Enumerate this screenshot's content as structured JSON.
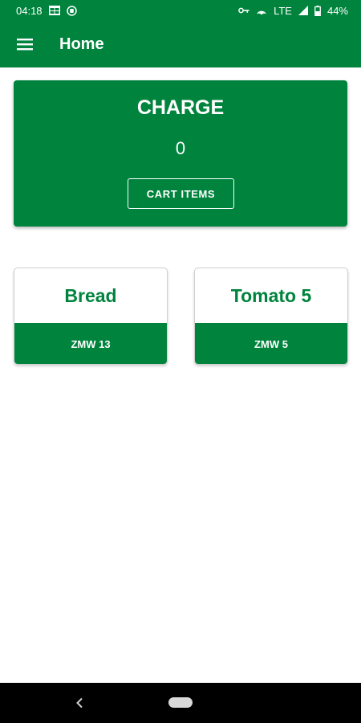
{
  "status_bar": {
    "time": "04:18",
    "network": "LTE",
    "battery": "44%",
    "icons": [
      "grid-notification-icon",
      "whatsapp-icon",
      "vpn-key-icon",
      "hotspot-icon",
      "signal-icon",
      "battery-icon"
    ]
  },
  "app_bar": {
    "title": "Home",
    "menu_icon": "hamburger-menu-icon"
  },
  "charge_card": {
    "title": "CHARGE",
    "amount": "0",
    "cart_button_label": "CART ITEMS"
  },
  "products": [
    {
      "name": "Bread",
      "price": "ZMW 13"
    },
    {
      "name": "Tomato 5",
      "price": "ZMW 5"
    }
  ],
  "nav_bar": {
    "back_icon": "back-chevron-icon",
    "home_icon": "home-pill-icon"
  },
  "colors": {
    "primary": "#00843d",
    "white": "#ffffff",
    "nav_background": "#000000"
  }
}
